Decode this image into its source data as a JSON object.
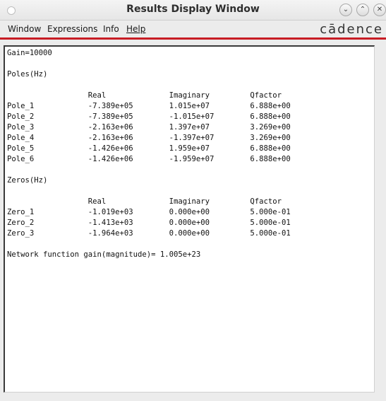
{
  "window": {
    "title": "Results Display Window",
    "controls": {
      "minimize": "⌄",
      "maximize": "⌃",
      "close": "✕"
    }
  },
  "menu": {
    "items": [
      "Window",
      "Expressions",
      "Info",
      "Help"
    ],
    "brand": "cādence"
  },
  "results": {
    "gain": "Gain=10000",
    "poles_header": "Poles(Hz)",
    "zeros_header": "Zeros(Hz)",
    "columns": [
      "Real",
      "Imaginary",
      "Qfactor"
    ],
    "poles": [
      {
        "name": "Pole_1",
        "real": "-7.389e+05",
        "imag": "1.015e+07",
        "q": "6.888e+00"
      },
      {
        "name": "Pole_2",
        "real": "-7.389e+05",
        "imag": "-1.015e+07",
        "q": "6.888e+00"
      },
      {
        "name": "Pole_3",
        "real": "-2.163e+06",
        "imag": "1.397e+07",
        "q": "3.269e+00"
      },
      {
        "name": "Pole_4",
        "real": "-2.163e+06",
        "imag": "-1.397e+07",
        "q": "3.269e+00"
      },
      {
        "name": "Pole_5",
        "real": "-1.426e+06",
        "imag": "1.959e+07",
        "q": "6.888e+00"
      },
      {
        "name": "Pole_6",
        "real": "-1.426e+06",
        "imag": "-1.959e+07",
        "q": "6.888e+00"
      }
    ],
    "zeros": [
      {
        "name": "Zero_1",
        "real": "-1.019e+03",
        "imag": "0.000e+00",
        "q": "5.000e-01"
      },
      {
        "name": "Zero_2",
        "real": "-1.413e+03",
        "imag": "0.000e+00",
        "q": "5.000e-01"
      },
      {
        "name": "Zero_3",
        "real": "-1.964e+03",
        "imag": "0.000e+00",
        "q": "5.000e-01"
      }
    ],
    "network_gain": "Network function gain(magnitude)= 1.005e+23"
  },
  "colors": {
    "accent_line": "#c81d25",
    "panel_bg": "#ffffff",
    "chrome_bg": "#ececec"
  }
}
